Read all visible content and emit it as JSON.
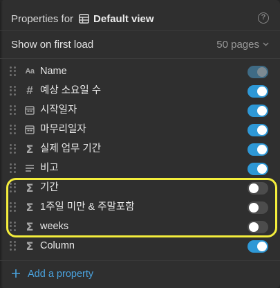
{
  "header": {
    "prefix": "Properties for",
    "view_name": "Default view",
    "table_icon": "table-icon",
    "help_icon": "question-circle-icon",
    "help_glyph": "?"
  },
  "load": {
    "label": "Show on first load",
    "value": "50 pages",
    "chevron": "chevron-down-icon"
  },
  "properties": [
    {
      "name": "Name",
      "icon": "text-aa-icon",
      "visible": true,
      "locked": true
    },
    {
      "name": "예상 소요일 수",
      "icon": "number-hash-icon",
      "visible": true,
      "locked": false
    },
    {
      "name": "시작일자",
      "icon": "calendar-icon",
      "visible": true,
      "locked": false
    },
    {
      "name": "마무리일자",
      "icon": "calendar-icon",
      "visible": true,
      "locked": false
    },
    {
      "name": "실제 업무 기간",
      "icon": "formula-sigma-icon",
      "visible": true,
      "locked": false
    },
    {
      "name": "비고",
      "icon": "text-lines-icon",
      "visible": true,
      "locked": false
    },
    {
      "name": "기간",
      "icon": "formula-sigma-icon",
      "visible": false,
      "locked": false
    },
    {
      "name": "1주일 미만 & 주말포함",
      "icon": "formula-sigma-icon",
      "visible": false,
      "locked": false
    },
    {
      "name": "weeks",
      "icon": "formula-sigma-icon",
      "visible": false,
      "locked": false
    },
    {
      "name": "Column",
      "icon": "formula-sigma-icon",
      "visible": true,
      "locked": false
    }
  ],
  "add_property": {
    "label": "Add a property",
    "icon": "plus-icon"
  },
  "colors": {
    "accent": "#2e98d6",
    "link": "#4aa3df",
    "highlight": "#f4ee3c",
    "panel": "#2f2f2f"
  }
}
